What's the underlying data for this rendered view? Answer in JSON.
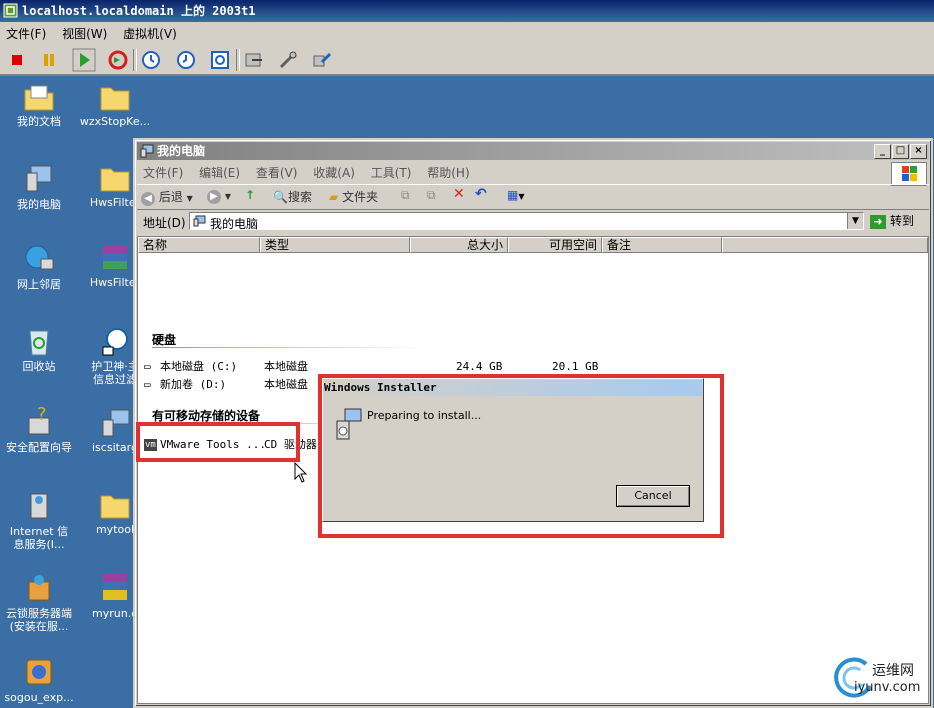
{
  "vmware": {
    "title": "localhost.localdomain 上的 2003t1",
    "menu": [
      "文件(F)",
      "视图(W)",
      "虚拟机(V)"
    ]
  },
  "desktop": {
    "icons": [
      {
        "label": "我的文档"
      },
      {
        "label": "wzxStopKe..."
      },
      {
        "label": "我的电脑"
      },
      {
        "label": "HwsFilter"
      },
      {
        "label": "网上邻居"
      },
      {
        "label": "HwsFilter"
      },
      {
        "label": "回收站"
      },
      {
        "label": "护卫神·主\n信息过滤"
      },
      {
        "label": "安全配置向导"
      },
      {
        "label": "iscsitarg"
      },
      {
        "label": "Internet 信\n息服务(I..."
      },
      {
        "label": "mytool"
      },
      {
        "label": "云锁服务器端\n(安装在服..."
      },
      {
        "label": "myrun.e"
      },
      {
        "label": "sogou_exp..."
      }
    ]
  },
  "explorer": {
    "title": "我的电脑",
    "menu": [
      "文件(F)",
      "编辑(E)",
      "查看(V)",
      "收藏(A)",
      "工具(T)",
      "帮助(H)"
    ],
    "toolbar": {
      "back": "后退",
      "search": "搜索",
      "folders": "文件夹"
    },
    "address": {
      "label": "地址(D)",
      "value": "我的电脑",
      "go": "转到"
    },
    "columns": [
      "名称",
      "类型",
      "总大小",
      "可用空间",
      "备注"
    ],
    "groups": {
      "hard_disks": "硬盘",
      "removable": "有可移动存储的设备"
    },
    "drives": [
      {
        "name": "本地磁盘 (C:)",
        "type": "本地磁盘",
        "total": "24.4 GB",
        "free": "20.1 GB"
      },
      {
        "name": "新加卷 (D:)",
        "type": "本地磁盘",
        "total": "",
        "free": ""
      }
    ],
    "removable": [
      {
        "name": "VMware Tools ...",
        "type": "CD 驱动器"
      }
    ]
  },
  "dialog": {
    "title": "Windows Installer",
    "message": "Preparing to install...",
    "cancel": "Cancel"
  },
  "watermark": {
    "line1": "运维网",
    "line2": "iyunv.com"
  },
  "colors": {
    "desktop": "#3a6ea5",
    "highlight": "#e03030",
    "title_active": "#0a246a"
  }
}
